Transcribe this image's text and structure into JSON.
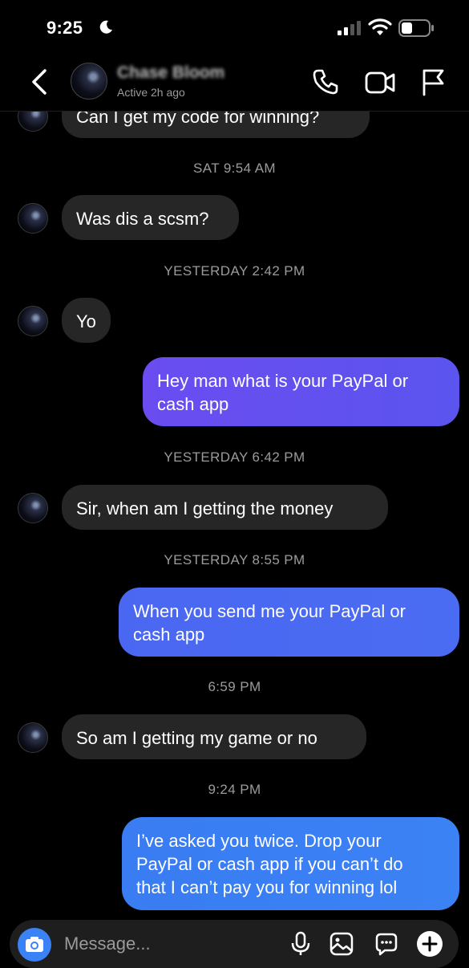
{
  "status_bar": {
    "time": "9:25"
  },
  "header": {
    "contact_name": "Chase Bloom",
    "contact_status": "Active 2h ago"
  },
  "messages": [
    {
      "type": "incoming",
      "text": "Can I get my code for winning?"
    },
    {
      "type": "timestamp",
      "text": "SAT 9:54 AM"
    },
    {
      "type": "incoming",
      "text": "Was dis a scsm?"
    },
    {
      "type": "timestamp",
      "text": "YESTERDAY 2:42 PM"
    },
    {
      "type": "incoming",
      "text": "Yo"
    },
    {
      "type": "outgoing",
      "lines": [
        "Hey man what is your PayPal or",
        "cash app"
      ]
    },
    {
      "type": "timestamp",
      "text": "YESTERDAY 6:42 PM"
    },
    {
      "type": "incoming",
      "text": "Sir, when am I getting the money"
    },
    {
      "type": "timestamp",
      "text": "YESTERDAY 8:55 PM"
    },
    {
      "type": "outgoing",
      "lines": [
        "When you send me your PayPal or",
        "cash app"
      ]
    },
    {
      "type": "timestamp",
      "text": "6:59 PM"
    },
    {
      "type": "incoming",
      "text": "So am I getting my game or no"
    },
    {
      "type": "timestamp",
      "text": "9:24 PM"
    },
    {
      "type": "outgoing",
      "lines": [
        "I’ve asked you twice. Drop your",
        "PayPal or cash app if you can’t do",
        "that I can’t pay you for winning lol"
      ]
    }
  ],
  "composer": {
    "placeholder": "Message..."
  },
  "colors": {
    "outgoing_1": "#6a4cf0",
    "outgoing_1_end": "#5b54ee",
    "outgoing_2": "#4a67f2",
    "outgoing_2_end": "#4a6cf2",
    "outgoing_3": "#3a7cf2",
    "outgoing_3_end": "#3b82f5",
    "incoming": "#262626"
  },
  "icons": [
    "back-chevron-icon",
    "phone-icon",
    "video-camera-icon",
    "flag-icon",
    "camera-icon",
    "microphone-icon",
    "gallery-icon",
    "sticker-icon",
    "plus-icon"
  ]
}
